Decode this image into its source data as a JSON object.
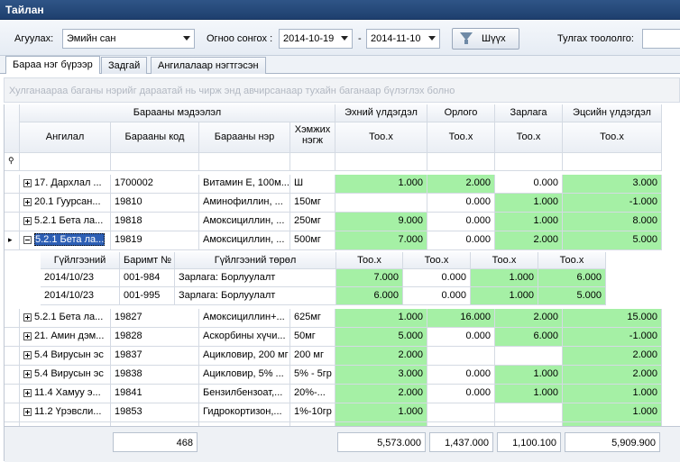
{
  "window": {
    "title": "Тайлан"
  },
  "filters": {
    "warehouse_label": "Агуулах:",
    "warehouse_value": "Эмийн сан",
    "date_label": "Огноо сонгох :",
    "date_from": "2014-10-19",
    "date_sep": "-",
    "date_to": "2014-11-10",
    "filter_button": "Шүүх",
    "count_label": "Тулгах тоололго:"
  },
  "tabs": [
    {
      "label": "Бараа нэг бүрээр"
    },
    {
      "label": "Задгай"
    },
    {
      "label": "Ангилалаар нэгтгэсэн"
    }
  ],
  "group_panel_hint": "Хулганаараа баганы нэрийг дараатай нь чирж энд авчирсанаар тухайн баганаар бүлэглэх болно",
  "grid": {
    "band_info": "Барааны мэдээлэл",
    "band_start": "Эхний үлдэгдэл",
    "band_in": "Орлого",
    "band_out": "Зарлага",
    "band_end": "Эцсийн үлдэгдэл",
    "col_category": "Ангилал",
    "col_code": "Барааны код",
    "col_name": "Барааны нэр",
    "col_unit": "Хэмжих нэгж",
    "col_qty": "Тоо.х",
    "rows_top": [
      {
        "cat": "17. Дархлал ...",
        "code": "1700002",
        "name": "Витамин Е, 100м...",
        "unit": "Ш",
        "start": "1.000",
        "in": "2.000",
        "out": "0.000",
        "end": "3.000"
      },
      {
        "cat": "20.1 Гуурсан...",
        "code": "19810",
        "name": "Аминофиллин, ...",
        "unit": "150мг",
        "start": "",
        "in": "0.000",
        "out": "1.000",
        "end": "-1.000"
      },
      {
        "cat": "5.2.1 Бета ла...",
        "code": "19818",
        "name": "Амоксициллин, ...",
        "unit": "250мг",
        "start": "9.000",
        "in": "0.000",
        "out": "1.000",
        "end": "8.000"
      },
      {
        "cat": "5.2.1 Бета ла...",
        "code": "19819",
        "name": "Амоксициллин, ...",
        "unit": "500мг",
        "start": "7.000",
        "in": "0.000",
        "out": "2.000",
        "end": "5.000"
      }
    ],
    "detail": {
      "col_date": "Гүйлгээний",
      "col_doc": "Баримт №",
      "col_type": "Гүйлгээний төрөл",
      "col_qty": "Тоо.х",
      "rows": [
        {
          "date": "2014/10/23",
          "doc": "001-984",
          "type": "Зарлага: Борлуулалт",
          "q1": "7.000",
          "q2": "0.000",
          "q3": "1.000",
          "q4": "6.000"
        },
        {
          "date": "2014/10/23",
          "doc": "001-995",
          "type": "Зарлага: Борлуулалт",
          "q1": "6.000",
          "q2": "0.000",
          "q3": "1.000",
          "q4": "5.000"
        }
      ]
    },
    "rows_bottom": [
      {
        "cat": "5.2.1 Бета ла...",
        "code": "19827",
        "name": "Амоксициллин+...",
        "unit": "625мг",
        "start": "1.000",
        "in": "16.000",
        "out": "2.000",
        "end": "15.000"
      },
      {
        "cat": "21. Амин дэм...",
        "code": "19828",
        "name": "Аскорбины хүчи...",
        "unit": "50мг",
        "start": "5.000",
        "in": "0.000",
        "out": "6.000",
        "end": "-1.000"
      },
      {
        "cat": "5.4 Вирусын эс",
        "code": "19837",
        "name": "Ацикловир, 200 мг",
        "unit": "200 мг",
        "start": "2.000",
        "in": "",
        "out": "",
        "end": "2.000"
      },
      {
        "cat": "5.4 Вирусын эс",
        "code": "19838",
        "name": "Ацикловир, 5% ...",
        "unit": "5% - 5гр",
        "start": "3.000",
        "in": "0.000",
        "out": "1.000",
        "end": "2.000"
      },
      {
        "cat": "11.4 Хамуу э...",
        "code": "19841",
        "name": "Бензилбензоат,...",
        "unit": "20%-...",
        "start": "2.000",
        "in": "0.000",
        "out": "1.000",
        "end": "1.000"
      },
      {
        "cat": "11.2 Үрэвсли...",
        "code": "19853",
        "name": "Гидрокортизон,...",
        "unit": "1%-10гр",
        "start": "1.000",
        "in": "",
        "out": "",
        "end": "1.000"
      }
    ],
    "footer": {
      "count": "468",
      "start": "5,573.000",
      "in": "1,437.000",
      "out": "1,100.100",
      "end": "5,909.900"
    }
  }
}
